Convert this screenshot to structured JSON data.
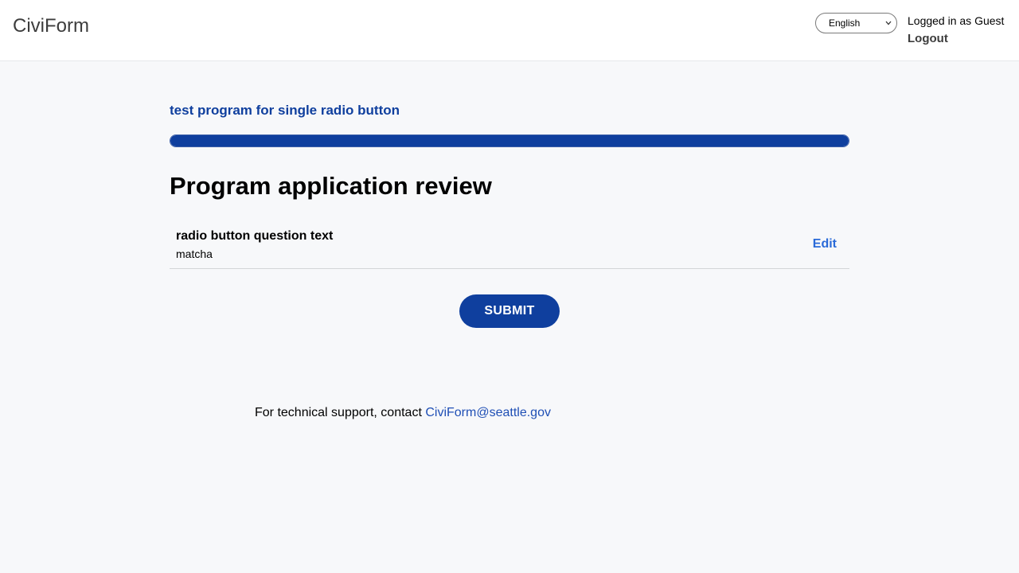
{
  "header": {
    "brand": "CiviForm",
    "language": {
      "selected": "English"
    },
    "user": {
      "logged_in_text": "Logged in as Guest",
      "logout_label": "Logout"
    }
  },
  "program": {
    "title": "test program for single radio button",
    "progress_fraction": 1.0
  },
  "review": {
    "title": "Program application review",
    "items": [
      {
        "question": "radio button question text",
        "answer": "matcha",
        "edit_label": "Edit"
      }
    ]
  },
  "actions": {
    "submit_label": "SUBMIT"
  },
  "footer": {
    "support_text": "For technical support, contact",
    "support_email": "CiviForm@seattle.gov"
  },
  "colors": {
    "primary": "#0f3f9e",
    "link": "#2a6ad8",
    "background": "#f7f8fa"
  }
}
